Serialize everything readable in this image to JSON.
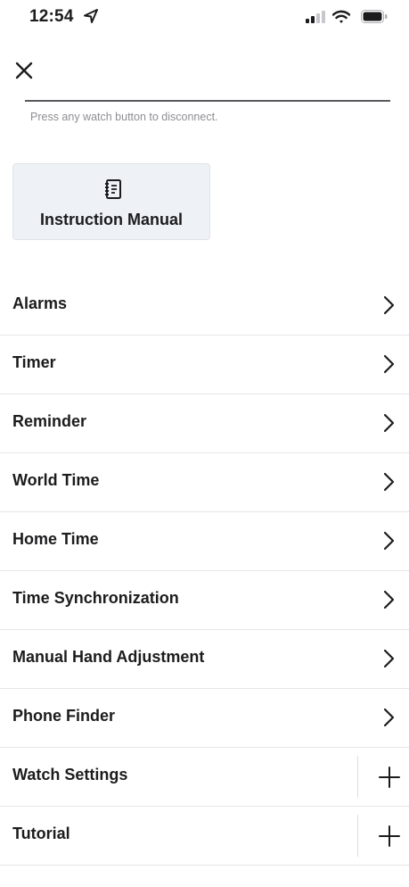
{
  "status_bar": {
    "time": "12:54",
    "icons": [
      "location-arrow-icon",
      "cellular-signal-icon",
      "wifi-icon",
      "battery-icon"
    ]
  },
  "header": {
    "close_icon": "close-icon",
    "hint": "Press any watch button to disconnect."
  },
  "manual_button": {
    "icon": "notebook-icon",
    "label": "Instruction Manual"
  },
  "menu": {
    "items": [
      {
        "label": "Alarms",
        "action": "chevron"
      },
      {
        "label": "Timer",
        "action": "chevron"
      },
      {
        "label": "Reminder",
        "action": "chevron"
      },
      {
        "label": "World Time",
        "action": "chevron"
      },
      {
        "label": "Home Time",
        "action": "chevron"
      },
      {
        "label": "Time Synchronization",
        "action": "chevron"
      },
      {
        "label": "Manual Hand Adjustment",
        "action": "chevron"
      },
      {
        "label": "Phone Finder",
        "action": "chevron"
      },
      {
        "label": "Watch Settings",
        "action": "expand"
      },
      {
        "label": "Tutorial",
        "action": "expand"
      }
    ]
  },
  "colors": {
    "text": "#1c1c1e",
    "hint": "#8e8e93",
    "button_bg": "#eef1f5",
    "separator": "#e6e6e9"
  }
}
